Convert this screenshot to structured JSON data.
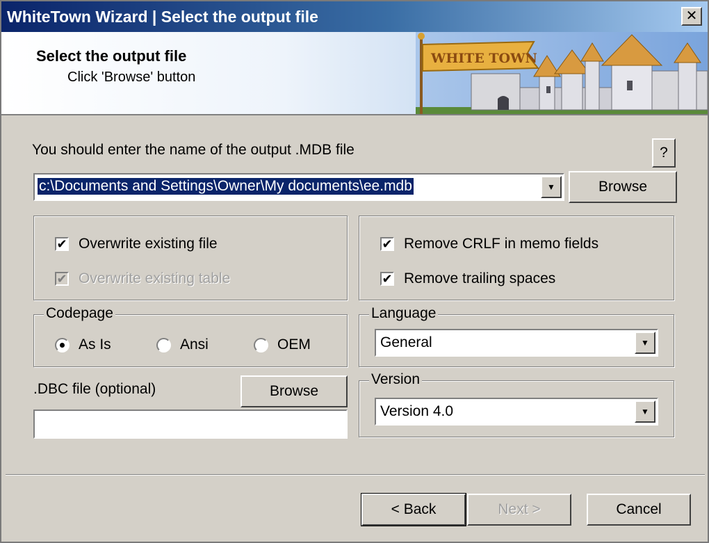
{
  "window": {
    "title": "WhiteTown Wizard | Select the output file",
    "close_label": "✕"
  },
  "header": {
    "title": "Select the output file",
    "subtitle": "Click 'Browse' button",
    "logo_text": "WHITE TOWN"
  },
  "output": {
    "prompt": "You should enter the name of the output .MDB file",
    "help_label": "?",
    "path_value": "c:\\Documents and Settings\\Owner\\My documents\\ee.mdb",
    "browse_label": "Browse"
  },
  "options": {
    "overwrite_file": {
      "label": "Overwrite existing file",
      "checked": true
    },
    "overwrite_table": {
      "label": "Overwrite existing table",
      "checked": true,
      "disabled": true
    },
    "remove_crlf": {
      "label": "Remove CRLF in memo fields",
      "checked": true
    },
    "remove_trailing": {
      "label": "Remove trailing spaces",
      "checked": true
    }
  },
  "codepage": {
    "label": "Codepage",
    "options": [
      {
        "label": "As Is",
        "selected": true
      },
      {
        "label": "Ansi",
        "selected": false
      },
      {
        "label": "OEM",
        "selected": false
      }
    ]
  },
  "language": {
    "label": "Language",
    "selected": "General"
  },
  "version": {
    "label": "Version",
    "selected": "Version 4.0"
  },
  "dbc": {
    "label": ".DBC file (optional)",
    "browse_label": "Browse",
    "value": ""
  },
  "footer": {
    "back_label": "< Back",
    "next_label": "Next >",
    "cancel_label": "Cancel"
  },
  "icons": {
    "check": "✔",
    "arrow": "▼"
  },
  "colors": {
    "title_start": "#0a246a",
    "title_end": "#a6caf0",
    "face": "#d4d0c8",
    "selection": "#0a246a"
  }
}
